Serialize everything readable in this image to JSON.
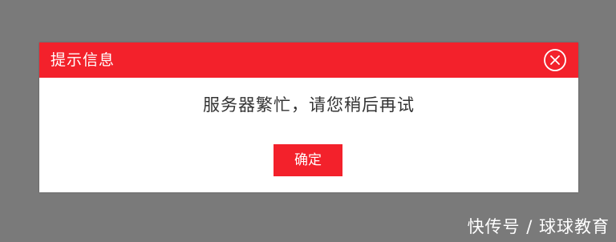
{
  "dialog": {
    "title": "提示信息",
    "message": "服务器繁忙，请您稍后再试",
    "ok_label": "确定",
    "close_icon": "close-circle-icon"
  },
  "watermark": {
    "text": "快传号 / 球球教育"
  },
  "colors": {
    "backdrop": "#7a7a7a",
    "accent": "#f3212b",
    "panel": "#ffffff",
    "message_text": "#333333"
  }
}
